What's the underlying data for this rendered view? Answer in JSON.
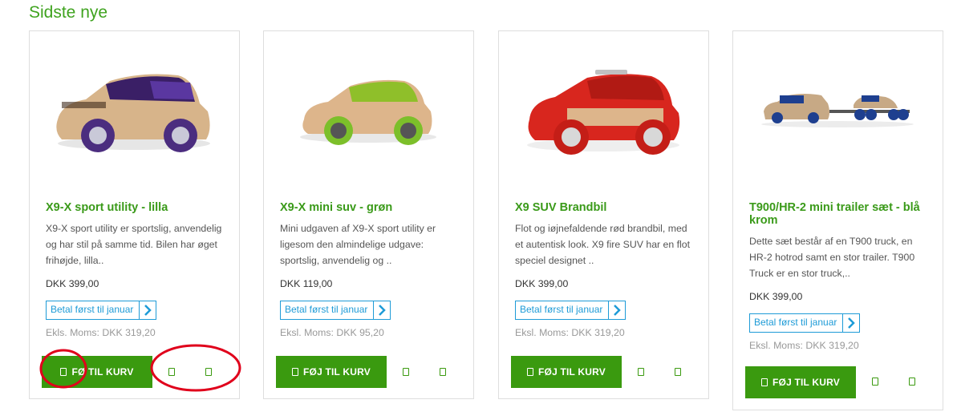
{
  "section": {
    "title": "Sidste nye"
  },
  "products": [
    {
      "title": "X9-X sport utility - lilla",
      "description": "X9-X sport utility er sportslig, anvendelig og har stil på samme tid. Bilen har øget frihøjde, lilla..",
      "price": "DKK 399,00",
      "pay_later": "Betal først til januar",
      "ex_vat": "Ekls. Moms: DKK 319,20",
      "cart_label": "FØ TIL KURV",
      "accent_color": "#5b2d8e"
    },
    {
      "title": "X9-X mini suv - grøn",
      "description": "Mini udgaven af X9-X sport utility er ligesom den almindelige udgave: sportslig, anvendelig og ..",
      "price": "DKK 119,00",
      "pay_later": "Betal først til januar",
      "ex_vat": "Eksl. Moms: DKK 95,20",
      "cart_label": "FØJ TIL KURV",
      "accent_color": "#7cbf2a"
    },
    {
      "title": "X9 SUV Brandbil",
      "description": "Flot og iøjnefaldende rød brandbil, med et autentisk look. X9 fire SUV har en flot speciel designet ..",
      "price": "DKK 399,00",
      "pay_later": "Betal først til januar",
      "ex_vat": "Eksl. Moms: DKK 319,20",
      "cart_label": "FØJ TIL KURV",
      "accent_color": "#d8261e"
    },
    {
      "title": "T900/HR-2 mini trailer sæt - blå krom",
      "description": "Dette sæt består af en T900 truck, en HR-2 hotrod samt en stor trailer. T900 Truck er en stor truck,..",
      "price": "DKK 399,00",
      "pay_later": "Betal først til januar",
      "ex_vat": "Eksl. Moms: DKK 319,20",
      "cart_label": "FØJ TIL KURV",
      "accent_color": "#1e3f8f"
    }
  ],
  "colors": {
    "brand_green": "#3a9a0f",
    "title_green": "#3fa31f",
    "pay_blue": "#1e9bd7",
    "annotation_red": "#e0001b"
  }
}
